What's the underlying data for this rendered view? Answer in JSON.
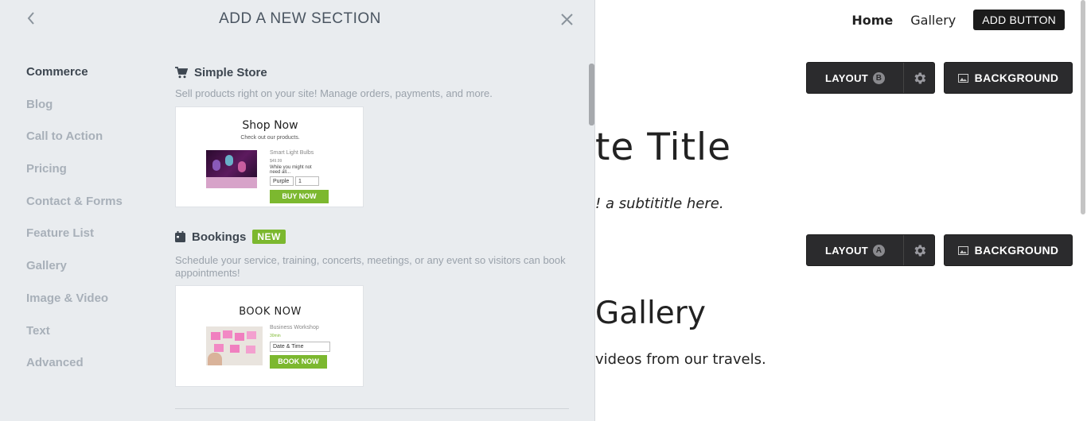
{
  "panel": {
    "title": "ADD A NEW SECTION",
    "categories": [
      {
        "label": "Commerce"
      },
      {
        "label": "Blog"
      },
      {
        "label": "Call to Action"
      },
      {
        "label": "Pricing"
      },
      {
        "label": "Contact & Forms"
      },
      {
        "label": "Feature List"
      },
      {
        "label": "Gallery"
      },
      {
        "label": "Image & Video"
      },
      {
        "label": "Text"
      },
      {
        "label": "Advanced"
      }
    ],
    "active_category": "Commerce",
    "store": {
      "title": "Simple Store",
      "description": "Sell products right on your site! Manage orders, payments, and more.",
      "preview": {
        "heading": "Shop Now",
        "subheading": "Check out our products.",
        "product_name": "Smart Light Bulbs",
        "price": "$49.99",
        "note": "While you might not need all...",
        "option": "Purple",
        "quantity": "1",
        "button": "BUY NOW"
      }
    },
    "bookings": {
      "title": "Bookings",
      "badge": "NEW",
      "description": "Schedule your service, training, concerts, meetings, or any event so visitors can book appointments!",
      "preview": {
        "heading": "BOOK NOW",
        "service_name": "Business Workshop",
        "duration": "30min",
        "field": "Date & Time",
        "button": "BOOK NOW"
      }
    }
  },
  "site": {
    "nav": {
      "home": "Home",
      "gallery": "Gallery",
      "add_button": "ADD BUTTON"
    },
    "section1": {
      "layout_label": "LAYOUT",
      "layout_letter": "B",
      "background_label": "BACKGROUND"
    },
    "title_fragment": "te Title",
    "subtitle_fragment": "! a subtititle here.",
    "section2": {
      "layout_label": "LAYOUT",
      "layout_letter": "A",
      "background_label": "BACKGROUND"
    },
    "gallery_title_fragment": "Gallery",
    "gallery_text_fragment": "videos from our travels."
  },
  "colors": {
    "panel_bg": "#e9ecef",
    "accent_green": "#7cb82f",
    "dark_button": "#2b2b2d"
  }
}
